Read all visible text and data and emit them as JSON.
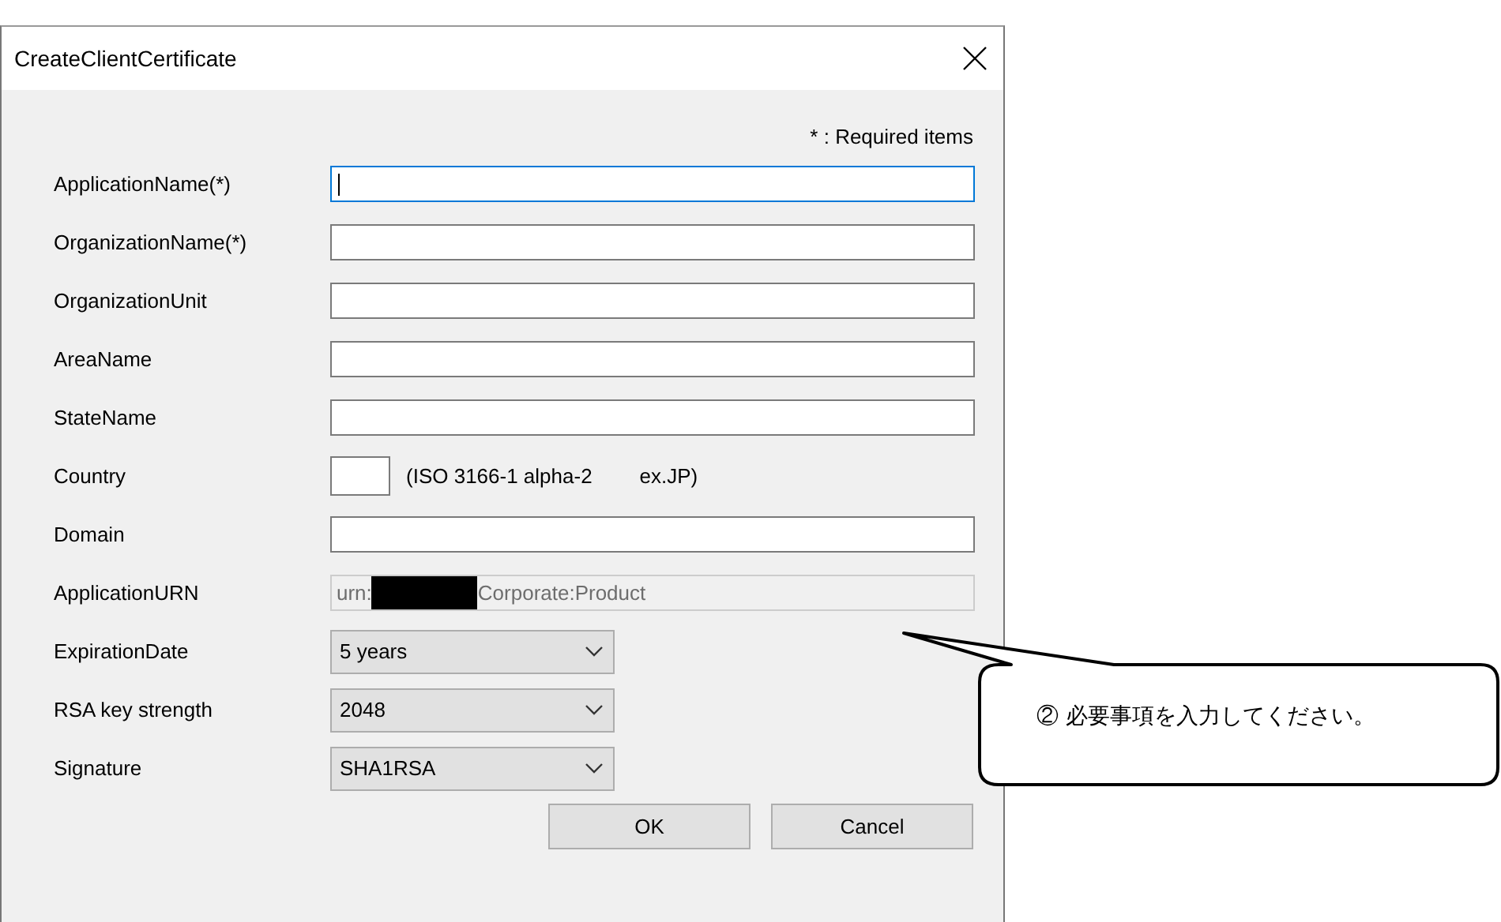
{
  "window": {
    "title": "CreateClientCertificate"
  },
  "required_note": "* : Required items",
  "fields": [
    {
      "kind": "text",
      "label": "ApplicationName(*)",
      "focused": true
    },
    {
      "kind": "text",
      "label": "OrganizationName(*)"
    },
    {
      "kind": "text",
      "label": "OrganizationUnit"
    },
    {
      "kind": "text",
      "label": "AreaName"
    },
    {
      "kind": "text",
      "label": "StateName"
    },
    {
      "kind": "country",
      "label": "Country",
      "hint": "(ISO 3166-1 alpha-2",
      "example": "ex.JP)"
    },
    {
      "kind": "text",
      "label": "Domain"
    },
    {
      "kind": "readonly",
      "label": "ApplicationURN",
      "value_prefix": "urn:",
      "value_suffix": "Corporate:Product"
    },
    {
      "kind": "select",
      "label": "ExpirationDate",
      "value": "5 years"
    },
    {
      "kind": "select",
      "label": "RSA key strength",
      "value": "2048"
    },
    {
      "kind": "select",
      "label": "Signature",
      "value": "SHA1RSA"
    }
  ],
  "buttons": [
    "OK",
    "Cancel"
  ],
  "callout": {
    "text": "② 必要事項を入力してください。"
  }
}
